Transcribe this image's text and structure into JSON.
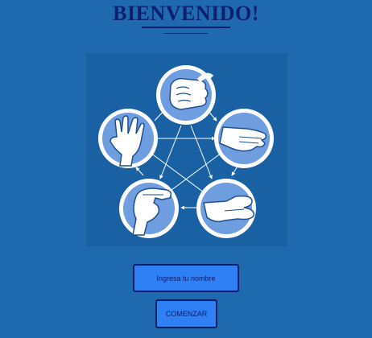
{
  "header": {
    "title": "BIENVENIDO!"
  },
  "form": {
    "name_placeholder": "Ingresa tu nombre",
    "name_value": "",
    "start_label": "COMENZAR"
  },
  "diagram": {
    "hands": [
      "rock-hand-icon",
      "paper-hand-icon",
      "scissors-hand-icon",
      "lizard-hand-icon",
      "spock-hand-icon"
    ]
  },
  "colors": {
    "background": "#1f6aae",
    "title": "#0d1f6e",
    "button": "#2f7ff5",
    "circle_fill": "#6f9ee0",
    "circle_ring": "#ffffff"
  }
}
